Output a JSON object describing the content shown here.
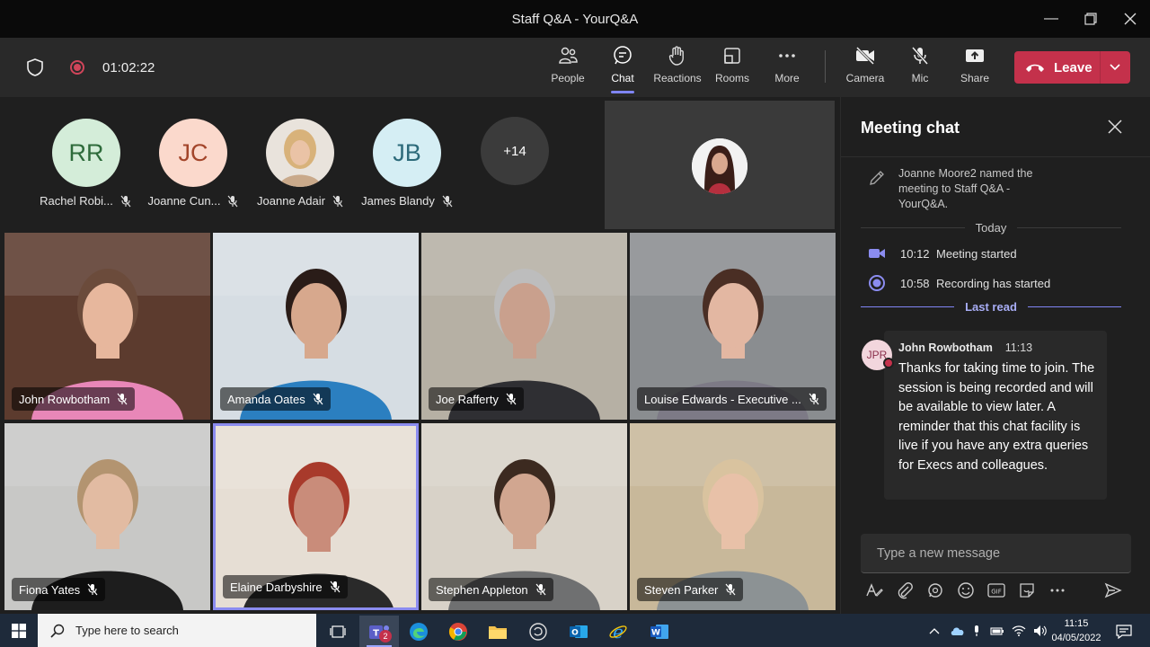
{
  "window": {
    "title": "Staff Q&A - YourQ&A"
  },
  "toolbar": {
    "timer": "01:02:22",
    "buttons": {
      "people": "People",
      "chat": "Chat",
      "reactions": "Reactions",
      "rooms": "Rooms",
      "more": "More",
      "camera": "Camera",
      "mic": "Mic",
      "share": "Share"
    },
    "leave": "Leave"
  },
  "roster": {
    "avatars": [
      {
        "initials": "RR",
        "name": "Rachel Robi...",
        "bg": "#d4edd9",
        "fg": "#2e6b3b"
      },
      {
        "initials": "JC",
        "name": "Joanne Cun...",
        "bg": "#fbd9cc",
        "fg": "#a3452a"
      },
      {
        "initials": "",
        "name": "Joanne Adair",
        "bg": "#e8d6b5",
        "fg": "#6b4e2a"
      },
      {
        "initials": "JB",
        "name": "James Blandy",
        "bg": "#d5eef4",
        "fg": "#2c6a7a"
      }
    ],
    "overflow": "+14"
  },
  "tiles": [
    {
      "name": "John Rowbotham",
      "bg": "#5c3b2e",
      "shirt": "#e887b8",
      "skin": "#e7b79d",
      "hair": "#6b4b3b"
    },
    {
      "name": "Amanda Oates",
      "bg": "#d6dde3",
      "shirt": "#2b7fc0",
      "skin": "#d7a88d",
      "hair": "#2a1c18"
    },
    {
      "name": "Joe Rafferty",
      "bg": "#b6b0a4",
      "shirt": "#2f2f33",
      "skin": "#c9a08d",
      "hair": "#bdbdbd"
    },
    {
      "name": "Louise Edwards - Executive ...",
      "bg": "#8a8d90",
      "shirt": "#7d7a86",
      "skin": "#e3b7a2",
      "hair": "#4a2e24"
    },
    {
      "name": "Fiona Yates",
      "bg": "#c8c8c6",
      "shirt": "#1d1d1d",
      "skin": "#e2bba2",
      "hair": "#b39470"
    },
    {
      "name": "Elaine Darbyshire",
      "bg": "#e6ded4",
      "shirt": "#2a2a2a",
      "skin": "#c98c7a",
      "hair": "#a83a2b"
    },
    {
      "name": "Stephen Appleton",
      "bg": "#d8d2c8",
      "shirt": "#6f7071",
      "skin": "#d1a690",
      "hair": "#3c2a20"
    },
    {
      "name": "Steven Parker",
      "bg": "#c8b89a",
      "shirt": "#8c9294",
      "skin": "#e8c1a8",
      "hair": "#d9c39f"
    }
  ],
  "chat": {
    "title": "Meeting chat",
    "system_message": "Joanne Moore2 named the meeting to Staff Q&A - YourQ&A.",
    "day": "Today",
    "events": [
      {
        "time": "10:12",
        "text": "Meeting started"
      },
      {
        "time": "10:58",
        "text": "Recording has started"
      }
    ],
    "last_read": "Last read",
    "message": {
      "initials": "JPR",
      "author": "John Rowbotham",
      "time": "11:13",
      "body": "Thanks for taking time to join. The session is being recorded and will be available to view later. A reminder that this chat facility is live if you have any extra queries for Execs and colleagues."
    },
    "compose_placeholder": "Type a new message"
  },
  "taskbar": {
    "search_placeholder": "Type here to search",
    "teams_badge": "2",
    "time": "11:15",
    "date": "04/05/2022"
  }
}
